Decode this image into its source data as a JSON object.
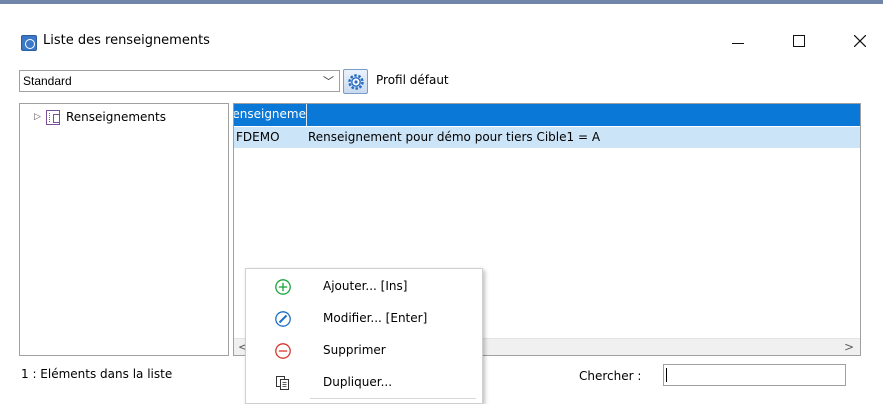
{
  "window": {
    "title": "Liste des renseignements",
    "controls": {
      "minimize": "—",
      "maximize": "☐",
      "close": "✕"
    }
  },
  "profile": {
    "selected": "Standard",
    "default_label": "Profil défaut",
    "icon": "gear-icon"
  },
  "tree": {
    "items": [
      {
        "label": "Renseignements",
        "icon": "list-view-icon",
        "expanded": false
      }
    ]
  },
  "list": {
    "header": {
      "col1": "Renseigneme",
      "col2": ""
    },
    "rows": [
      {
        "code": "FDEMO",
        "label": "Renseignement pour démo pour tiers Cible1 = A"
      }
    ],
    "scroll": {
      "left": "<",
      "right": ">"
    }
  },
  "status": {
    "count_text": "1 : Eléments dans la liste",
    "search_label": "Chercher :",
    "search_value": ""
  },
  "context_menu": {
    "items": [
      {
        "label": "Ajouter... [Ins]",
        "icon": "add-icon"
      },
      {
        "label": "Modifier... [Enter]",
        "icon": "edit-icon"
      },
      {
        "label": "Supprimer",
        "icon": "delete-icon"
      },
      {
        "label": "Dupliquer...",
        "icon": "duplicate-icon"
      }
    ]
  },
  "colors": {
    "accent": "#0a78d7",
    "selected_row": "#cce4f7",
    "add_green": "#19a33a",
    "edit_blue": "#1f6fc6",
    "delete_red": "#d9332b"
  }
}
